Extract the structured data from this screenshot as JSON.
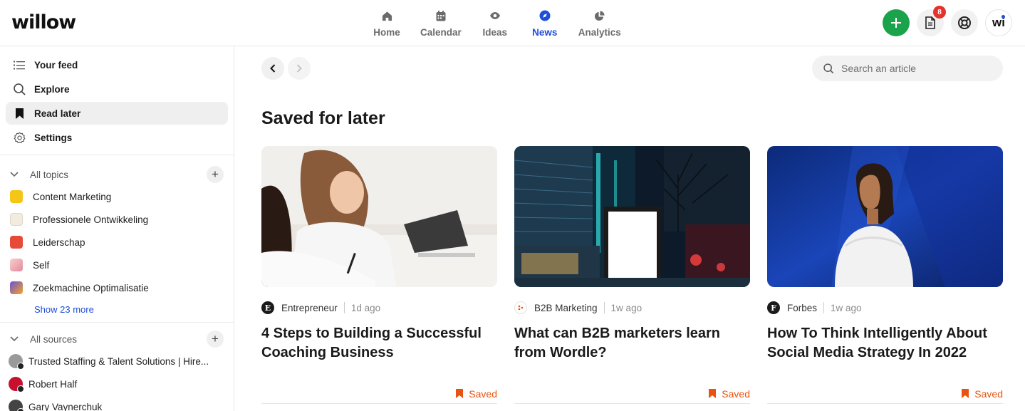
{
  "brand": {
    "logo_text": "willow"
  },
  "nav": {
    "items": [
      {
        "label": "Home",
        "icon": "home-icon",
        "active": false
      },
      {
        "label": "Calendar",
        "icon": "calendar-icon",
        "active": false
      },
      {
        "label": "Ideas",
        "icon": "eye-icon",
        "active": false
      },
      {
        "label": "News",
        "icon": "compass-icon",
        "active": true
      },
      {
        "label": "Analytics",
        "icon": "pie-chart-icon",
        "active": false
      }
    ],
    "active_color": "#1f4fd8"
  },
  "actions": {
    "notification_count": "8",
    "avatar_initials": "wi",
    "plus_color": "#1aa34a"
  },
  "sidebar": {
    "menu": [
      {
        "label": "Your feed",
        "icon": "list-icon"
      },
      {
        "label": "Explore",
        "icon": "search-icon"
      },
      {
        "label": "Read later",
        "icon": "bookmark-icon",
        "active": true
      },
      {
        "label": "Settings",
        "icon": "gear-icon"
      }
    ],
    "topics_header": "All topics",
    "topics": [
      {
        "label": "Content Marketing",
        "color": "#f5c518"
      },
      {
        "label": "Professionele Ontwikkeling",
        "color": "#f1ebe0"
      },
      {
        "label": "Leiderschap",
        "color": "#e84a3a"
      },
      {
        "label": "Self",
        "color": "#f1b8b8"
      },
      {
        "label": "Zoekmachine Optimalisatie",
        "color": "#6c4fd8"
      }
    ],
    "show_more": "Show 23 more",
    "sources_header": "All sources",
    "sources": [
      {
        "label": "Trusted Staffing & Talent Solutions | Hire...",
        "color": "#9a9a9a"
      },
      {
        "label": "Robert Half",
        "color": "#c8102e"
      },
      {
        "label": "Gary Vaynerchuk",
        "color": "#444"
      }
    ]
  },
  "main": {
    "search_placeholder": "Search an article",
    "title": "Saved for later",
    "cards": [
      {
        "source": "Entrepreneur",
        "source_logo": "E",
        "time": "1d ago",
        "title": "4 Steps to Building a Successful Coaching Business",
        "status": "Saved",
        "image": "women-working-laptop"
      },
      {
        "source": "B2B Marketing",
        "source_logo": "",
        "time": "1w ago",
        "title": "What can B2B marketers learn from Wordle?",
        "status": "Saved",
        "image": "city-night-billboard"
      },
      {
        "source": "Forbes",
        "source_logo": "F",
        "time": "1w ago",
        "title": "How To Think Intelligently About Social Media Strategy In 2022",
        "status": "Saved",
        "image": "woman-blue-wall-sunlight"
      }
    ],
    "saved_color": "#e8540f"
  }
}
